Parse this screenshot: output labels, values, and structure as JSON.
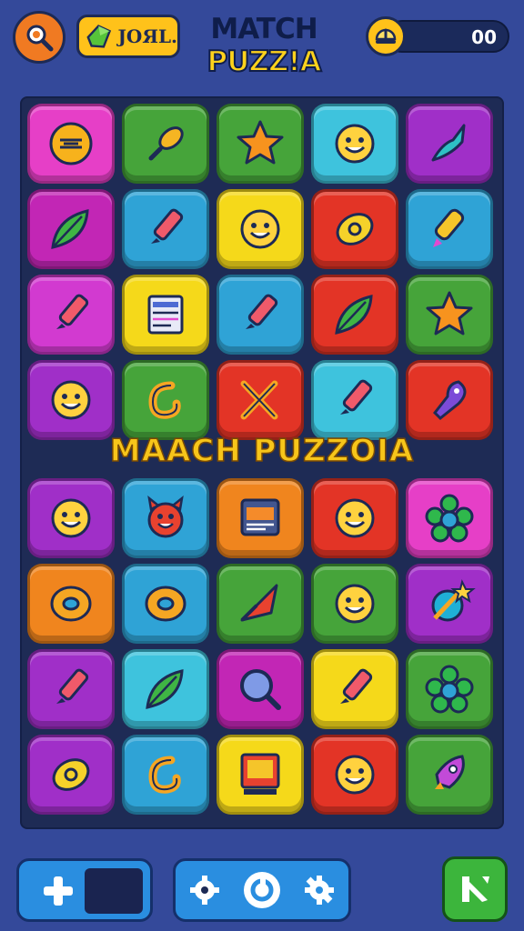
{
  "header": {
    "coins_label": "JOЯL.",
    "title_line1": "MATCH",
    "title_line2": "PUZZ!A",
    "score": "00"
  },
  "banner": "MAACH PUZZOIA",
  "colors": {
    "background": "#34499a",
    "board": "#1e2b55",
    "banner": "#f7c51a"
  },
  "board": {
    "rows": [
      [
        {
          "color": "#e63fc7",
          "icon": "text-badge-icon"
        },
        {
          "color": "#46a43a",
          "icon": "leaf-pin-icon"
        },
        {
          "color": "#46a43a",
          "icon": "star-icon"
        },
        {
          "color": "#3ec3dd",
          "icon": "smiley-face-icon"
        },
        {
          "color": "#a02fc8",
          "icon": "bird-icon"
        }
      ],
      [
        {
          "color": "#c226b5",
          "icon": "leaf-icon"
        },
        {
          "color": "#2fa3d6",
          "icon": "marker-icon"
        },
        {
          "color": "#f5d91a",
          "icon": "smiley-face-icon"
        },
        {
          "color": "#e33426",
          "icon": "lemon-icon"
        },
        {
          "color": "#2fa3d6",
          "icon": "crayon-icon"
        }
      ],
      [
        {
          "color": "#d23ad0",
          "icon": "marker-icon"
        },
        {
          "color": "#f5d91a",
          "icon": "document-icon"
        },
        {
          "color": "#2fa3d6",
          "icon": "marker-icon"
        },
        {
          "color": "#e33426",
          "icon": "leaf-icon"
        },
        {
          "color": "#46a43a",
          "icon": "star-icon"
        }
      ],
      [
        {
          "color": "#a02fc8",
          "icon": "smiley-face-icon"
        },
        {
          "color": "#46a43a",
          "icon": "swirl-icon"
        },
        {
          "color": "#e33426",
          "icon": "crossed-tools-icon"
        },
        {
          "color": "#3ec3dd",
          "icon": "marker-icon"
        },
        {
          "color": "#e33426",
          "icon": "squid-icon"
        }
      ],
      [
        {
          "color": "#a02fc8",
          "icon": "smiley-face-icon"
        },
        {
          "color": "#2fa3d6",
          "icon": "devil-face-icon"
        },
        {
          "color": "#f0851e",
          "icon": "window-icon"
        },
        {
          "color": "#e33426",
          "icon": "smiley-face-icon"
        },
        {
          "color": "#e63fc7",
          "icon": "flower-icon"
        }
      ],
      [
        {
          "color": "#f0851e",
          "icon": "donut-icon"
        },
        {
          "color": "#2fa3d6",
          "icon": "donut-icon"
        },
        {
          "color": "#46a43a",
          "icon": "pennant-icon"
        },
        {
          "color": "#46a43a",
          "icon": "smiley-face-icon"
        },
        {
          "color": "#a02fc8",
          "icon": "magic-wand-icon"
        }
      ],
      [
        {
          "color": "#a02fc8",
          "icon": "marker-icon"
        },
        {
          "color": "#3ec3dd",
          "icon": "leaf-icon"
        },
        {
          "color": "#c226b5",
          "icon": "search-icon"
        },
        {
          "color": "#f5d91a",
          "icon": "marker-icon"
        },
        {
          "color": "#46a43a",
          "icon": "flower-icon"
        }
      ],
      [
        {
          "color": "#a02fc8",
          "icon": "lemon-icon"
        },
        {
          "color": "#2fa3d6",
          "icon": "swirl-icon"
        },
        {
          "color": "#f5d91a",
          "icon": "monitor-icon"
        },
        {
          "color": "#e33426",
          "icon": "smiley-face-icon"
        },
        {
          "color": "#46a43a",
          "icon": "rocket-icon"
        }
      ]
    ]
  }
}
